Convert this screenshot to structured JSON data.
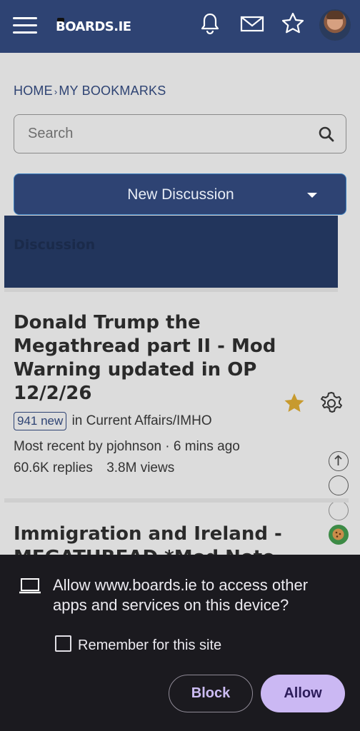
{
  "header": {
    "logo": "BOARDS.IE",
    "icons": [
      "menu-icon",
      "bell-icon",
      "mail-icon",
      "star-icon",
      "avatar"
    ]
  },
  "breadcrumb": {
    "home": "HOME",
    "sep": "›",
    "current": "MY BOOKMARKS"
  },
  "search": {
    "placeholder": "Search"
  },
  "new_discussion": {
    "label": "New Discussion"
  },
  "discussion_header": {
    "label": "Discussion"
  },
  "threads": [
    {
      "title": "Donald Trump the Megathread part II - Mod Warning updated in OP 12/2/26",
      "new_badge": "941 new",
      "category": "in Current Affairs/IMHO",
      "recent": "Most recent by pjohnson · 6 mins ago",
      "replies": "60.6K replies",
      "views": "3.8M views"
    },
    {
      "title": "Immigration and Ireland - MEGATHREAD *Mod Note"
    }
  ],
  "permission_dialog": {
    "message": "Allow www.boards.ie to access other apps and services on this device?",
    "remember_label": "Remember for this site",
    "block_label": "Block",
    "allow_label": "Allow"
  },
  "colors": {
    "header_bg": "#2e4373",
    "accent": "#2e4373",
    "star": "#c79a2e",
    "dialog_bg": "#1b1a1f",
    "allow_bg": "#cbb8f3"
  }
}
